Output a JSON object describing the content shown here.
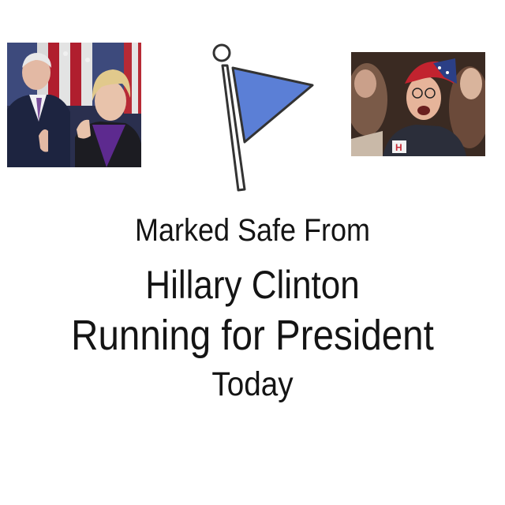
{
  "meme": {
    "line_1": "Marked Safe From",
    "line_2": "Hillary Clinton",
    "line_3": "Running for President",
    "line_4": "Today"
  },
  "icons": {
    "flag": "flag-icon"
  },
  "colors": {
    "background": "#ffffff",
    "flag_fill": "#5b7fd6",
    "flag_outline": "#333333",
    "text": "#141414"
  }
}
